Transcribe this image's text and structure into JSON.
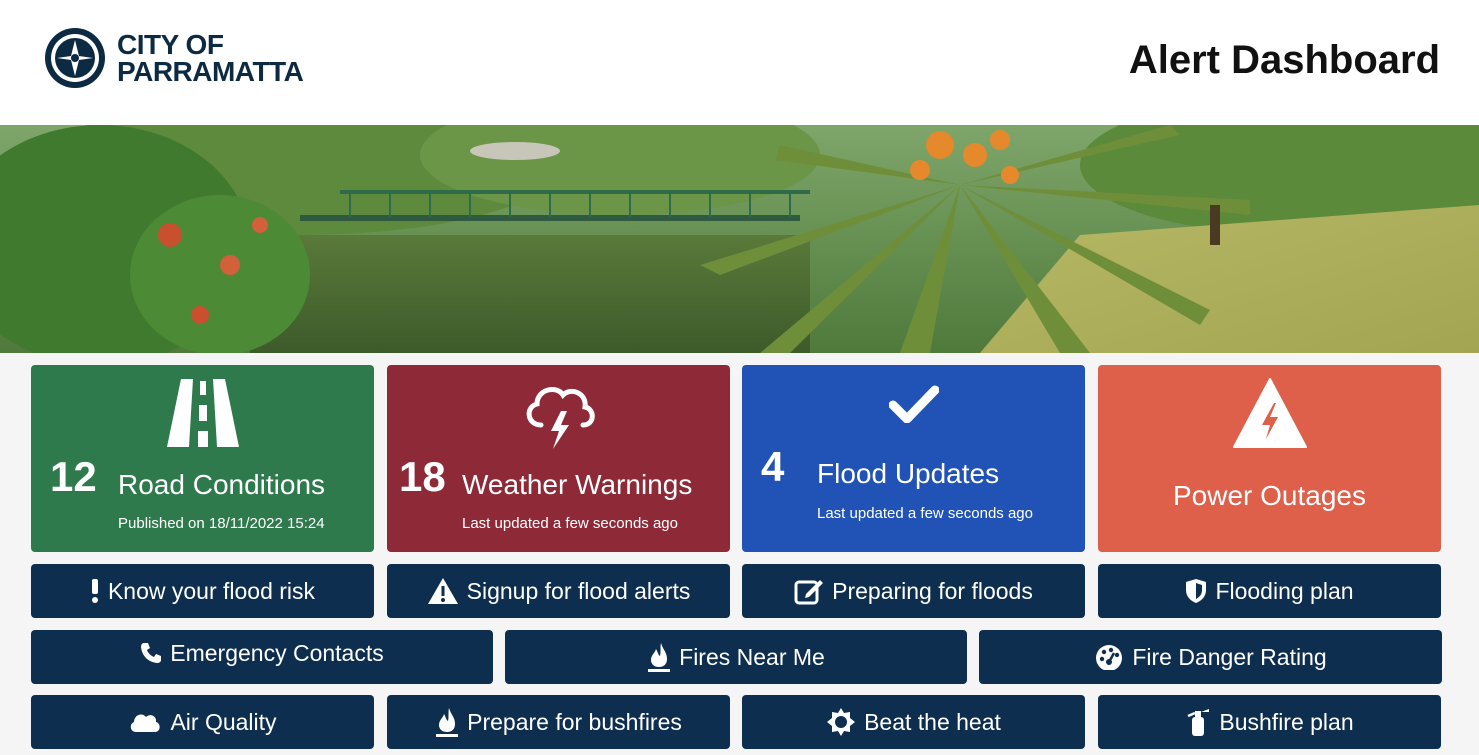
{
  "header": {
    "logo_line1": "CITY OF",
    "logo_line2": "PARRAMATTA",
    "title": "Alert Dashboard"
  },
  "colors": {
    "navy": "#0d2e4f",
    "road": "#2e7a4c",
    "weather": "#8e2a38",
    "flood": "#2152b5",
    "power": "#de5f4a"
  },
  "cards": [
    {
      "count": "12",
      "label": "Road Conditions",
      "sub": "Published on 18/11/2022 15:24",
      "icon": "road-icon"
    },
    {
      "count": "18",
      "label": "Weather Warnings",
      "sub": "Last updated a few seconds ago",
      "icon": "storm-cloud-icon"
    },
    {
      "count": "4",
      "label": "Flood Updates",
      "sub": "Last updated a few seconds ago",
      "icon": "checkmark-icon"
    },
    {
      "count": "",
      "label": "Power Outages",
      "sub": "",
      "icon": "power-warning-icon"
    }
  ],
  "row1": [
    {
      "label": "Know your flood risk",
      "icon": "exclamation-icon"
    },
    {
      "label": "Signup for flood alerts",
      "icon": "warning-triangle-icon"
    },
    {
      "label": "Preparing for floods",
      "icon": "edit-icon"
    },
    {
      "label": "Flooding plan",
      "icon": "shield-icon"
    }
  ],
  "row2": [
    {
      "label": "Emergency Contacts",
      "icon": "phone-icon"
    },
    {
      "label": "Fires Near Me",
      "icon": "fire-icon"
    },
    {
      "label": "Fire Danger Rating",
      "icon": "gauge-icon"
    }
  ],
  "row3": [
    {
      "label": "Air Quality",
      "icon": "cloud-icon"
    },
    {
      "label": "Prepare for bushfires",
      "icon": "fire-icon"
    },
    {
      "label": "Beat the heat",
      "icon": "sun-icon"
    },
    {
      "label": "Bushfire plan",
      "icon": "fire-extinguisher-icon"
    }
  ]
}
